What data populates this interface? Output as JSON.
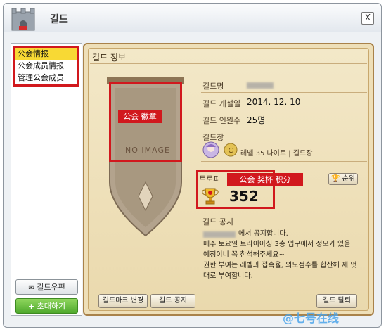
{
  "window": {
    "title": "길드",
    "close_label": "X"
  },
  "sidebar": {
    "items": [
      {
        "label": "公会情报",
        "selected": true
      },
      {
        "label": "公会成员情报",
        "selected": false
      },
      {
        "label": "管理公会成员",
        "selected": false
      }
    ],
    "mail_button": "길드우편",
    "invite_button": "초대하기"
  },
  "panel": {
    "title": "길드 정보",
    "emblem_tag": "公会 徽章",
    "no_image": "NO IMAGE",
    "fields": {
      "name_label": "길드명",
      "founded_label": "길드 개설일",
      "founded_value": "2014. 12. 10",
      "members_label": "길드 인원수",
      "members_value": "25명",
      "master_label": "길드장",
      "master_info": "레벨 35 나이트 | 길드장"
    },
    "trophy": {
      "label": "트로피",
      "tag": "公会 奖杯 积分",
      "score": "352",
      "rank_button": "순위"
    },
    "notice": {
      "label": "길드 공지",
      "lines": [
        "에서 공지합니다.",
        "매주 토요일 트라이아싱 3층 입구에서 정모가 있을",
        "예정이니 꼭 참석해주세요~",
        "권한 부여는 레벨과 접속율, 외모점수를 합산해 제 멋",
        "대로 부여합니다."
      ]
    },
    "buttons": {
      "emblem_change": "길드마크 변경",
      "notice": "길드 공지",
      "leave": "길드 탈퇴"
    }
  },
  "watermark": "七号在线",
  "colors": {
    "highlight_red": "#d1181d",
    "selected_yellow": "#f8d934",
    "parchment": "#eedfb8"
  }
}
